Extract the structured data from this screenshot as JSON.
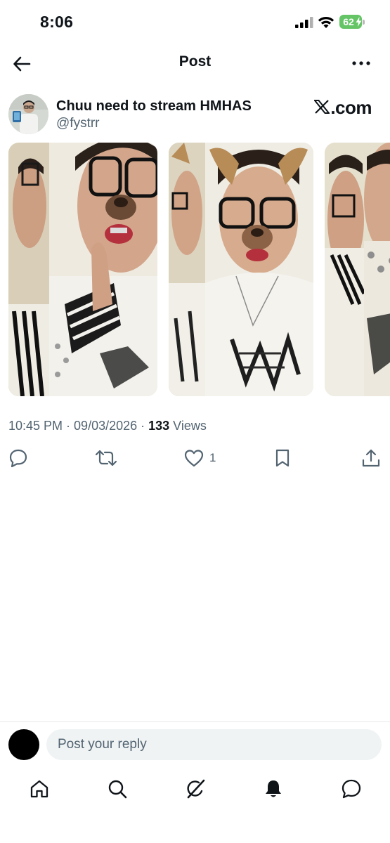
{
  "status_bar": {
    "time": "8:06",
    "battery_percent": "62",
    "battery_color": "#65c466"
  },
  "header": {
    "title": "Post",
    "back_icon": "arrow-left-icon",
    "more_icon": "more-horizontal-icon"
  },
  "post": {
    "author": {
      "display_name": "Chuu need to stream HMHAS",
      "handle": "@fystrr"
    },
    "source_label": ".com",
    "media_count": 3,
    "timestamp": "10:45 PM · 09/03/2026 · ",
    "views_count": "133",
    "views_label": " Views",
    "actions": {
      "reply_icon": "reply-icon",
      "repost_icon": "repost-icon",
      "like_icon": "heart-icon",
      "like_count": "1",
      "bookmark_icon": "bookmark-icon",
      "share_icon": "share-icon"
    }
  },
  "reply": {
    "placeholder": "Post your reply"
  },
  "tab_bar": {
    "items": [
      "home-icon",
      "search-icon",
      "grok-icon",
      "notifications-icon",
      "messages-icon"
    ]
  },
  "colors": {
    "text_primary": "#0f1419",
    "text_secondary": "#536471",
    "input_bg": "#eff3f4",
    "divider": "#e7e9ea"
  }
}
